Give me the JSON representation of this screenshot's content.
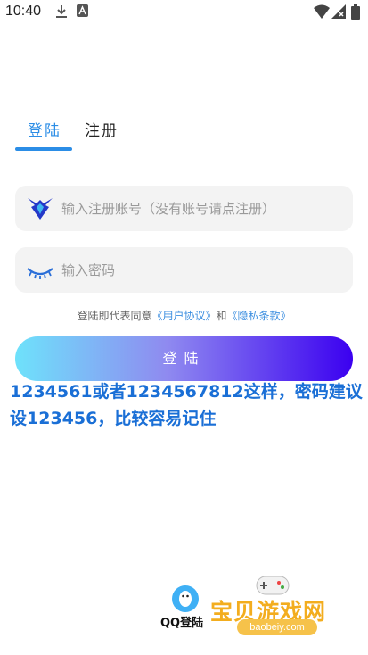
{
  "status_bar": {
    "time": "10:40"
  },
  "tabs": [
    {
      "label": "登陆",
      "active": true
    },
    {
      "label": "注册",
      "active": false
    }
  ],
  "account_field": {
    "value": "",
    "placeholder": "输入注册账号（没有账号请点注册）",
    "icon": "bird-logo-icon"
  },
  "password_field": {
    "value": "",
    "placeholder": "输入密码",
    "icon": "closed-eye-icon"
  },
  "agreement": {
    "prefix": "登陆即代表同意",
    "user_agreement": "《用户协议》",
    "conjunction": "和",
    "privacy_policy": "《隐私条款》"
  },
  "login_button": {
    "label": "登陆"
  },
  "hint": {
    "text": "1234561或者1234567812这样，密码建议设123456，比较容易记住"
  },
  "qq_login": {
    "label": "QQ登陆",
    "icon": "qq-penguin-icon"
  },
  "watermark": {
    "text": "宝贝游戏网",
    "url": "baobeiy.com"
  },
  "colors": {
    "accent": "#2b8de6",
    "button_start": "#6ee2fb",
    "button_end": "#3b00f0",
    "hint": "#1a6fd6"
  }
}
